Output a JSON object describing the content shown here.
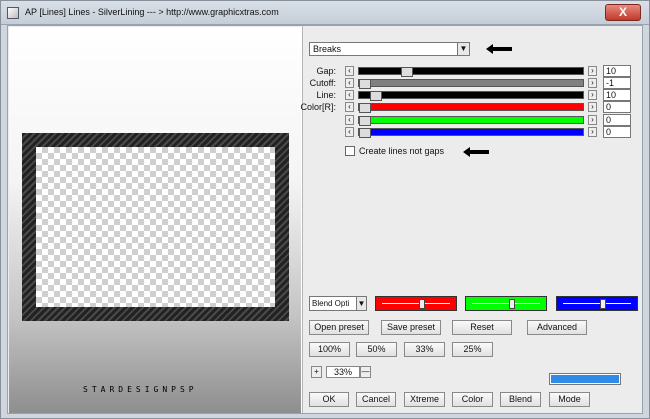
{
  "window": {
    "title": "AP [Lines]  Lines - SilverLining    --- > http://www.graphicxtras.com",
    "close_label": "X"
  },
  "preview": {
    "watermark": "STARDESIGNPSP"
  },
  "mode_dropdown": {
    "value": "Breaks"
  },
  "sliders": [
    {
      "label": "Gap:",
      "value": "10",
      "track_color": "#000000",
      "thumb_pos": 0.2
    },
    {
      "label": "Cutoff:",
      "value": "-1",
      "track_color": "#808080",
      "thumb_pos": 0.0
    },
    {
      "label": "Line:",
      "value": "10",
      "track_color": "#000000",
      "thumb_pos": 0.05
    },
    {
      "label": "Color[R]:",
      "value": "0",
      "track_color": "#ff0000",
      "thumb_pos": 0.0
    },
    {
      "label": "",
      "value": "0",
      "track_color": "#00ff00",
      "thumb_pos": 0.0
    },
    {
      "label": "",
      "value": "0",
      "track_color": "#0000ff",
      "thumb_pos": 0.0
    }
  ],
  "checkbox": {
    "label": "Create lines not gaps",
    "checked": false
  },
  "blend_select": {
    "value": "Blend Opti"
  },
  "color_swatches": [
    {
      "color": "#ff0000",
      "thumb_pos": 0.6
    },
    {
      "color": "#00ff00",
      "thumb_pos": 0.6
    },
    {
      "color": "#0000ff",
      "thumb_pos": 0.6
    }
  ],
  "preset_buttons": [
    "Open preset",
    "Save preset",
    "Reset",
    "Advanced"
  ],
  "zoom_buttons": [
    "100%",
    "50%",
    "33%",
    "25%"
  ],
  "zoom_stepper": {
    "minus_label": "+",
    "value": "33%",
    "plus_label": "—"
  },
  "progress": {
    "fraction": 1.0,
    "color": "#2f8ae8"
  },
  "action_buttons": [
    "OK",
    "Cancel",
    "Xtreme",
    "Color",
    "Blend",
    "Mode"
  ]
}
